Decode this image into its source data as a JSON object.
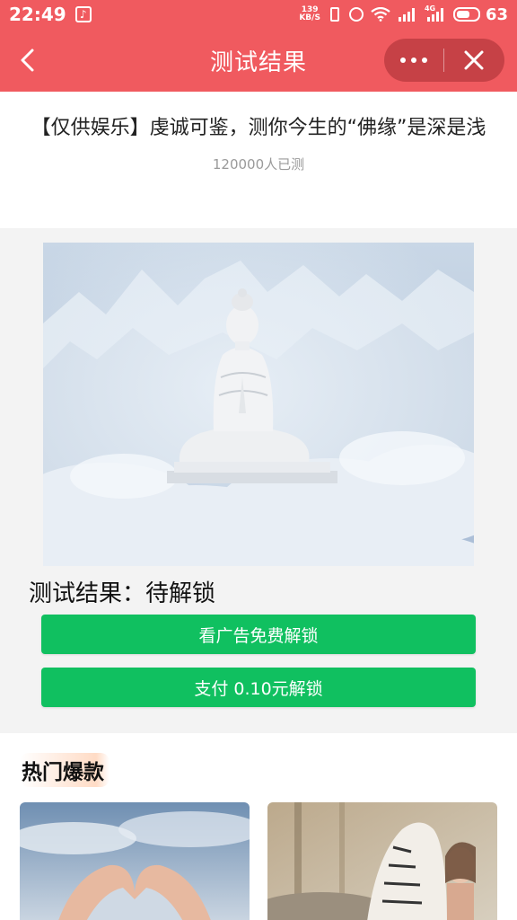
{
  "status_bar": {
    "time": "22:49",
    "net_speed_value": "139",
    "net_speed_unit": "KB/S",
    "network_4g": "4G",
    "battery": "63",
    "battery_level": 0.63,
    "icons": [
      "tiktok-icon",
      "vibrate-icon",
      "alarm-icon",
      "wifi-icon",
      "signal-icon",
      "battery-icon"
    ]
  },
  "nav": {
    "title": "测试结果",
    "icons": [
      "back-arrow-icon",
      "more-dots-icon",
      "close-icon"
    ]
  },
  "header": {
    "quiz_title": "【仅供娱乐】虔诚可鉴，测你今生的“佛缘”是深是浅",
    "test_count": "120000人已测"
  },
  "result": {
    "label": "测试结果：待解锁",
    "ad_unlock_button": "看广告免费解锁",
    "pay_unlock_button": "支付 0.10元解锁"
  },
  "hot": {
    "title": "热门爆款"
  },
  "colors": {
    "brand": "#f05a5f",
    "button": "#10c060",
    "section_bg": "#f3f3f3"
  }
}
